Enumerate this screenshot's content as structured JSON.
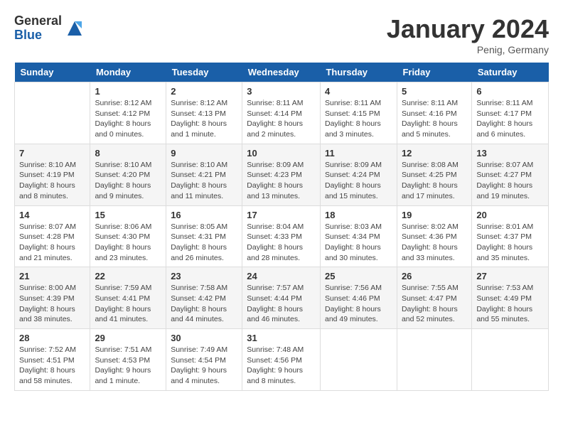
{
  "header": {
    "logo_general": "General",
    "logo_blue": "Blue",
    "month_title": "January 2024",
    "location": "Penig, Germany"
  },
  "days_of_week": [
    "Sunday",
    "Monday",
    "Tuesday",
    "Wednesday",
    "Thursday",
    "Friday",
    "Saturday"
  ],
  "weeks": [
    [
      {
        "day": "",
        "info": ""
      },
      {
        "day": "1",
        "info": "Sunrise: 8:12 AM\nSunset: 4:12 PM\nDaylight: 8 hours\nand 0 minutes."
      },
      {
        "day": "2",
        "info": "Sunrise: 8:12 AM\nSunset: 4:13 PM\nDaylight: 8 hours\nand 1 minute."
      },
      {
        "day": "3",
        "info": "Sunrise: 8:11 AM\nSunset: 4:14 PM\nDaylight: 8 hours\nand 2 minutes."
      },
      {
        "day": "4",
        "info": "Sunrise: 8:11 AM\nSunset: 4:15 PM\nDaylight: 8 hours\nand 3 minutes."
      },
      {
        "day": "5",
        "info": "Sunrise: 8:11 AM\nSunset: 4:16 PM\nDaylight: 8 hours\nand 5 minutes."
      },
      {
        "day": "6",
        "info": "Sunrise: 8:11 AM\nSunset: 4:17 PM\nDaylight: 8 hours\nand 6 minutes."
      }
    ],
    [
      {
        "day": "7",
        "info": "Sunrise: 8:10 AM\nSunset: 4:19 PM\nDaylight: 8 hours\nand 8 minutes."
      },
      {
        "day": "8",
        "info": "Sunrise: 8:10 AM\nSunset: 4:20 PM\nDaylight: 8 hours\nand 9 minutes."
      },
      {
        "day": "9",
        "info": "Sunrise: 8:10 AM\nSunset: 4:21 PM\nDaylight: 8 hours\nand 11 minutes."
      },
      {
        "day": "10",
        "info": "Sunrise: 8:09 AM\nSunset: 4:23 PM\nDaylight: 8 hours\nand 13 minutes."
      },
      {
        "day": "11",
        "info": "Sunrise: 8:09 AM\nSunset: 4:24 PM\nDaylight: 8 hours\nand 15 minutes."
      },
      {
        "day": "12",
        "info": "Sunrise: 8:08 AM\nSunset: 4:25 PM\nDaylight: 8 hours\nand 17 minutes."
      },
      {
        "day": "13",
        "info": "Sunrise: 8:07 AM\nSunset: 4:27 PM\nDaylight: 8 hours\nand 19 minutes."
      }
    ],
    [
      {
        "day": "14",
        "info": "Sunrise: 8:07 AM\nSunset: 4:28 PM\nDaylight: 8 hours\nand 21 minutes."
      },
      {
        "day": "15",
        "info": "Sunrise: 8:06 AM\nSunset: 4:30 PM\nDaylight: 8 hours\nand 23 minutes."
      },
      {
        "day": "16",
        "info": "Sunrise: 8:05 AM\nSunset: 4:31 PM\nDaylight: 8 hours\nand 26 minutes."
      },
      {
        "day": "17",
        "info": "Sunrise: 8:04 AM\nSunset: 4:33 PM\nDaylight: 8 hours\nand 28 minutes."
      },
      {
        "day": "18",
        "info": "Sunrise: 8:03 AM\nSunset: 4:34 PM\nDaylight: 8 hours\nand 30 minutes."
      },
      {
        "day": "19",
        "info": "Sunrise: 8:02 AM\nSunset: 4:36 PM\nDaylight: 8 hours\nand 33 minutes."
      },
      {
        "day": "20",
        "info": "Sunrise: 8:01 AM\nSunset: 4:37 PM\nDaylight: 8 hours\nand 35 minutes."
      }
    ],
    [
      {
        "day": "21",
        "info": "Sunrise: 8:00 AM\nSunset: 4:39 PM\nDaylight: 8 hours\nand 38 minutes."
      },
      {
        "day": "22",
        "info": "Sunrise: 7:59 AM\nSunset: 4:41 PM\nDaylight: 8 hours\nand 41 minutes."
      },
      {
        "day": "23",
        "info": "Sunrise: 7:58 AM\nSunset: 4:42 PM\nDaylight: 8 hours\nand 44 minutes."
      },
      {
        "day": "24",
        "info": "Sunrise: 7:57 AM\nSunset: 4:44 PM\nDaylight: 8 hours\nand 46 minutes."
      },
      {
        "day": "25",
        "info": "Sunrise: 7:56 AM\nSunset: 4:46 PM\nDaylight: 8 hours\nand 49 minutes."
      },
      {
        "day": "26",
        "info": "Sunrise: 7:55 AM\nSunset: 4:47 PM\nDaylight: 8 hours\nand 52 minutes."
      },
      {
        "day": "27",
        "info": "Sunrise: 7:53 AM\nSunset: 4:49 PM\nDaylight: 8 hours\nand 55 minutes."
      }
    ],
    [
      {
        "day": "28",
        "info": "Sunrise: 7:52 AM\nSunset: 4:51 PM\nDaylight: 8 hours\nand 58 minutes."
      },
      {
        "day": "29",
        "info": "Sunrise: 7:51 AM\nSunset: 4:53 PM\nDaylight: 9 hours\nand 1 minute."
      },
      {
        "day": "30",
        "info": "Sunrise: 7:49 AM\nSunset: 4:54 PM\nDaylight: 9 hours\nand 4 minutes."
      },
      {
        "day": "31",
        "info": "Sunrise: 7:48 AM\nSunset: 4:56 PM\nDaylight: 9 hours\nand 8 minutes."
      },
      {
        "day": "",
        "info": ""
      },
      {
        "day": "",
        "info": ""
      },
      {
        "day": "",
        "info": ""
      }
    ]
  ]
}
